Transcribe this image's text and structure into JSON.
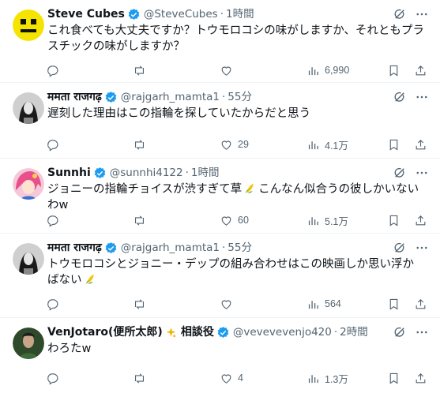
{
  "posts": [
    {
      "name": "Steve Cubes",
      "handle": "@SteveCubes",
      "time": "1時間",
      "text": "これ食べても大丈夫ですか？トウモロコシの味がしますか、それともプラスチックの味がしますか？",
      "replies": "",
      "retweets": "",
      "likes": "",
      "views": "6,990",
      "avatar": "yellow-smiley-avatar"
    },
    {
      "name": "ममता राजगढ़",
      "handle": "@rajgarh_mamta1",
      "time": "55分",
      "text": "遅刻した理由はこの指輪を探していたからだと思う",
      "replies": "",
      "retweets": "",
      "likes": "29",
      "views": "4.1万",
      "avatar": "woman-bw-avatar"
    },
    {
      "name": "Sunnhi",
      "handle": "@sunnhi4122",
      "time": "1時間",
      "text_a": "ジョニーの指輪チョイスが渋すぎて草",
      "text_b": "こんなん似合うの彼しかいないわw",
      "replies": "",
      "retweets": "",
      "likes": "60",
      "views": "5.1万",
      "avatar": "anime-pink-hair-avatar"
    },
    {
      "name": "ममता राजगढ़",
      "handle": "@rajgarh_mamta1",
      "time": "55分",
      "text_a": "トウモロコシとジョニー・デップの組み合わせはこの映画しか思い浮かばない",
      "replies": "",
      "retweets": "",
      "likes": "",
      "views": "564",
      "avatar": "woman-bw-avatar"
    },
    {
      "name": "VenJotaro(便所太郎)",
      "name_suffix": "相談役",
      "handle": "@vevevevenjo420",
      "time": "2時間",
      "text": "わろたw",
      "replies": "",
      "retweets": "",
      "likes": "4",
      "views": "1.3万",
      "avatar": "green-character-avatar"
    }
  ],
  "separator": "·",
  "colors": {
    "verified": "#1d9bf0",
    "muted": "#536471",
    "text": "#0f1419",
    "border": "#eff3f4"
  },
  "icons": [
    "reply-icon",
    "retweet-icon",
    "like-icon",
    "views-icon",
    "bookmark-icon",
    "share-icon",
    "grok-icon",
    "more-icon",
    "verified-badge-icon",
    "corn-emoji-icon",
    "sparkle-emoji-icon"
  ]
}
